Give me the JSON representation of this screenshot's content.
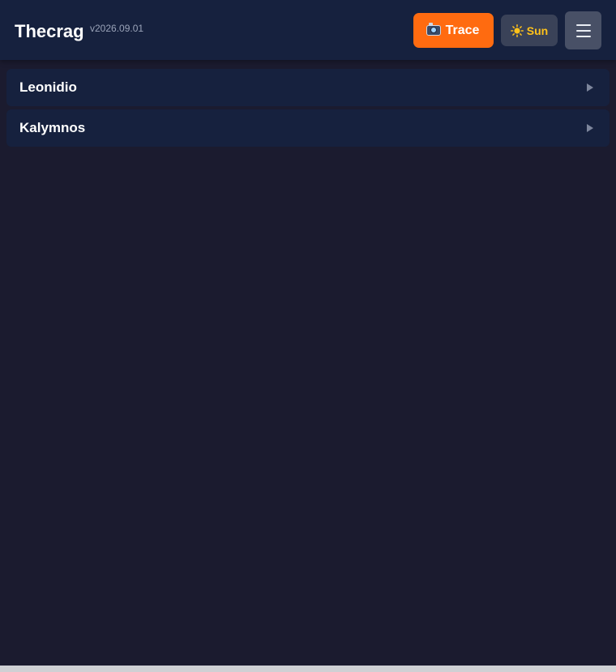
{
  "header": {
    "title": "Thecrag",
    "version": "v2026.09.01",
    "trace_label": "Trace",
    "trace_icon": "camera-icon",
    "sun_label": "Sun",
    "sun_icon": "sun-icon",
    "menu_icon": "hamburger-menu-icon"
  },
  "areas": [
    {
      "name": "Leonidio",
      "icon": "chevron-right-icon"
    },
    {
      "name": "Kalymnos",
      "icon": "chevron-right-icon"
    }
  ],
  "colors": {
    "background": "#1b1b2f",
    "header": "#16213e",
    "accent_orange": "#ff6b10",
    "sun_yellow": "#ffc21a",
    "row": "#16213e"
  }
}
